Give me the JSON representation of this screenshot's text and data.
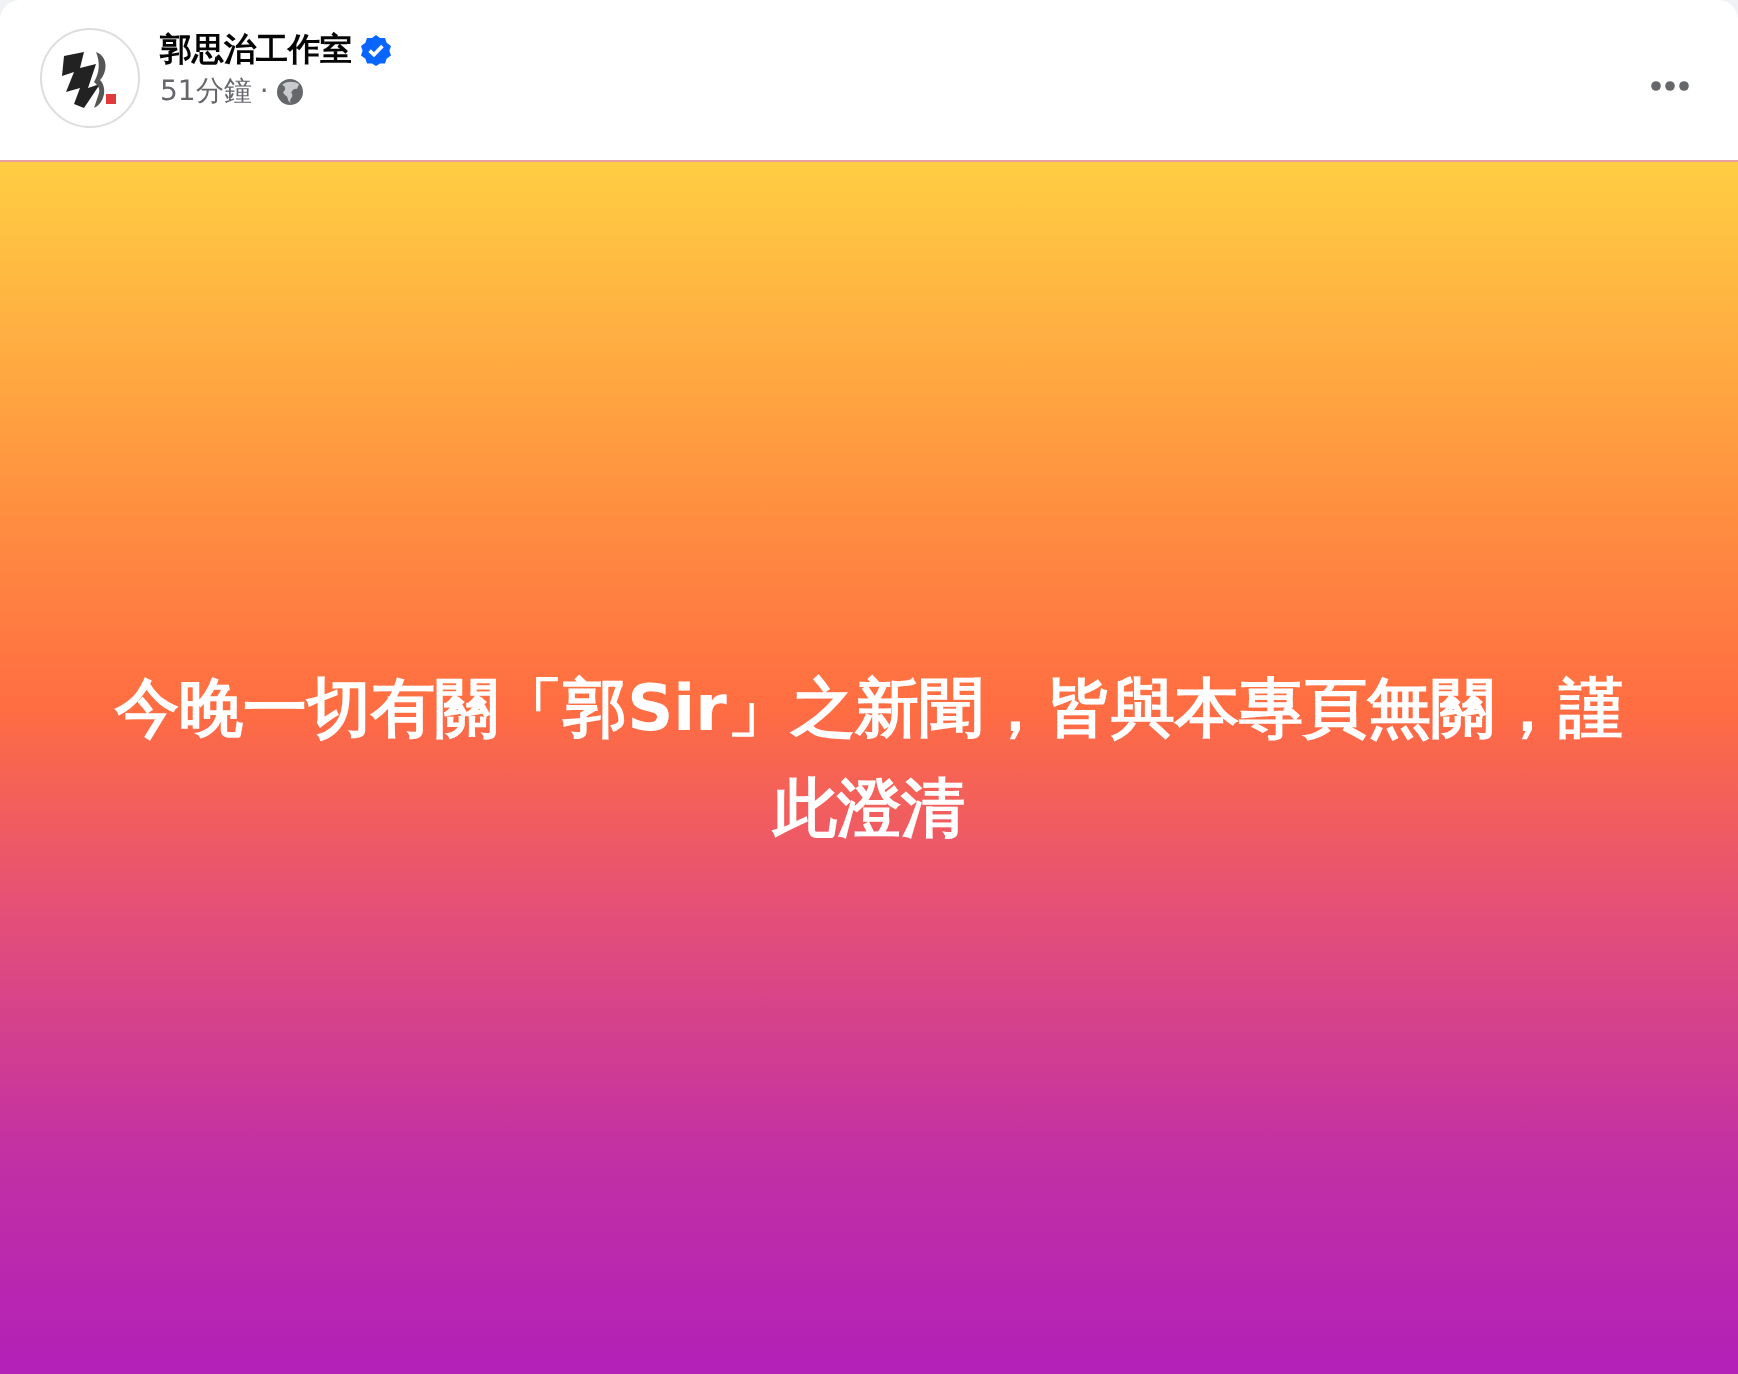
{
  "post": {
    "author": "郭思治工作室",
    "verified": true,
    "time": "51分鐘",
    "separator": "·",
    "public": true,
    "text": "今晚一切有關「郭Sir」之新聞，皆與本專頁無關，謹此澄清"
  }
}
